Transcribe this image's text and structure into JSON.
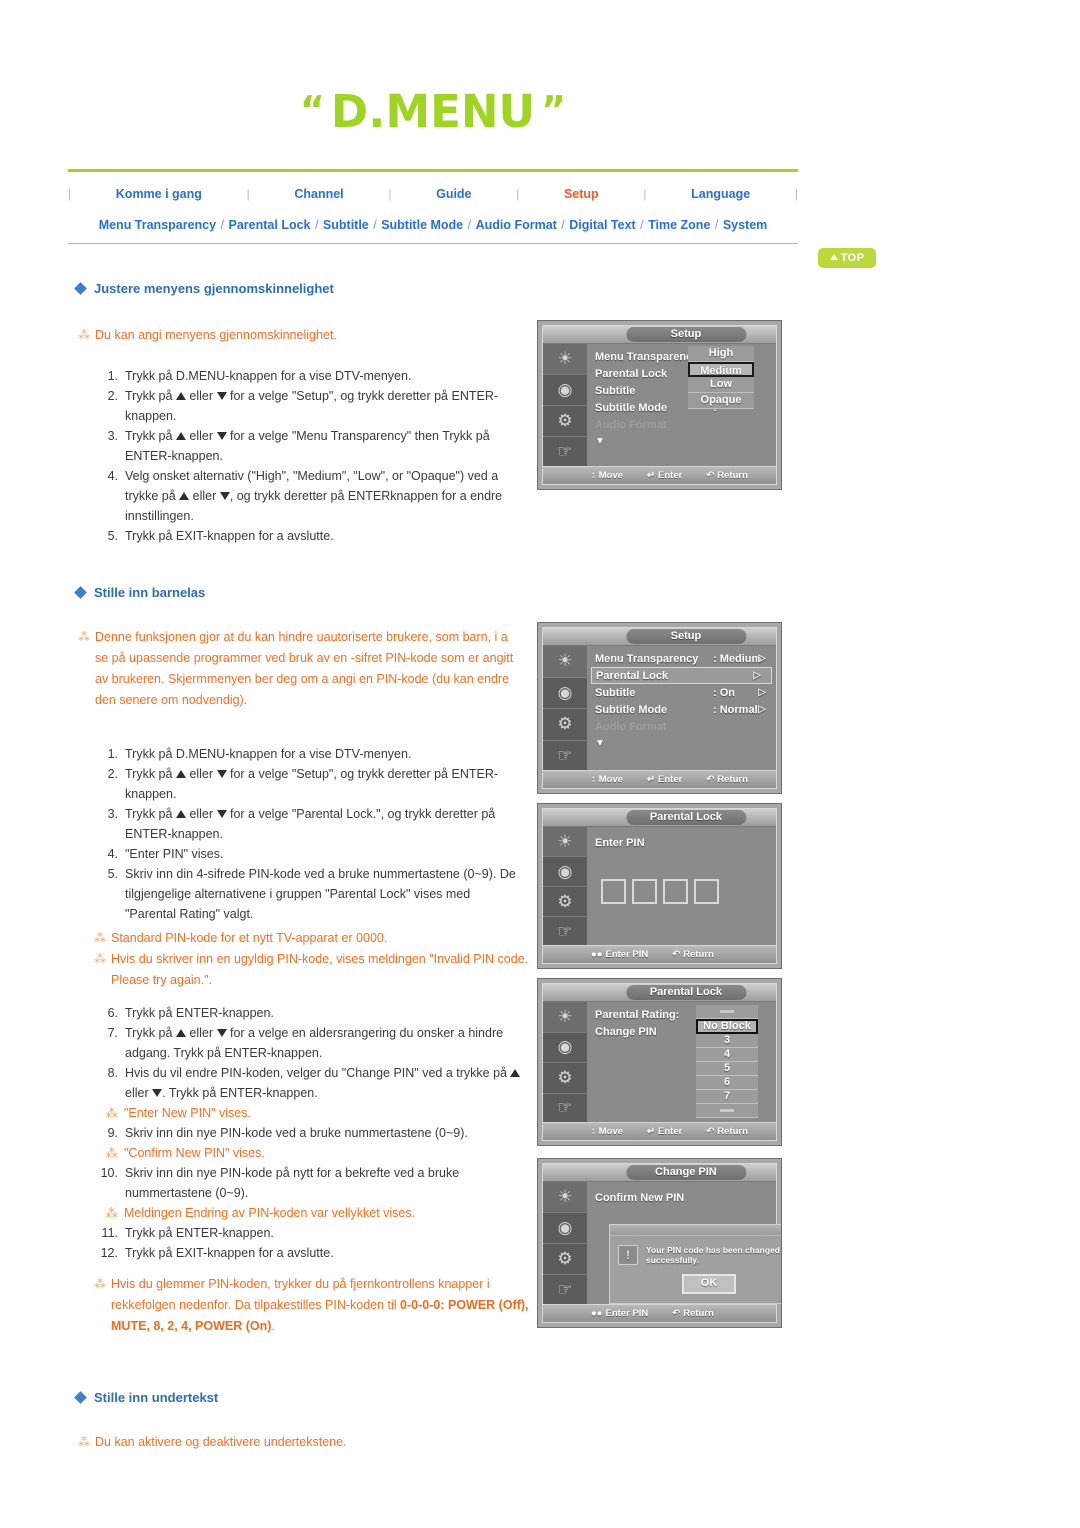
{
  "header": {
    "title": "D.MENU",
    "quote_open": "“",
    "quote_close": "”",
    "nav_items": [
      {
        "label": "Komme i gang",
        "active": false
      },
      {
        "label": "Channel",
        "active": false
      },
      {
        "label": "Guide",
        "active": false
      },
      {
        "label": "Setup",
        "active": true
      },
      {
        "label": "Language",
        "active": false
      }
    ],
    "subnav_items": [
      "Menu Transparency",
      "Parental Lock",
      "Subtitle",
      "Subtitle Mode",
      "Audio Format",
      "Digital Text",
      "Time Zone",
      "System"
    ],
    "top_button": "TOP"
  },
  "section1": {
    "heading": "Justere menyens gjennomskinnelighet",
    "note": "Du kan angi menyens gjennomskinnelighet.",
    "steps": [
      {
        "num": "1.",
        "text": "Trykk på D.MENU-knappen for a vise DTV-menyen."
      },
      {
        "num": "2.",
        "text_a": "Trykk på ",
        "text_b": " eller ",
        "text_c": " for a velge \"Setup\", og trykk deretter på ENTER-knappen."
      },
      {
        "num": "3.",
        "text_a": "Trykk på ",
        "text_b": " eller ",
        "text_c": " for a velge \"Menu Transparency\" then Trykk på ENTER-knappen."
      },
      {
        "num": "4.",
        "text_a": "Velg onsket alternativ (\"High\", \"Medium\", \"Low\", or \"Opaque\") ved a trykke på ",
        "text_b": " eller ",
        "text_c": ", og trykk deretter på ENTERknappen for a endre innstillingen."
      },
      {
        "num": "5.",
        "text": "Trykk på EXIT-knappen for a avslutte."
      }
    ]
  },
  "section2": {
    "heading": "Stille inn barnelas",
    "note": "Denne funksjonen gjor at du kan hindre uautoriserte brukere, som barn, i a se på upassende programmer ved bruk av en -sifret PIN-kode som er angitt av brukeren. Skjermmenyen ber deg om a angi en PIN-kode (du kan endre den senere om nodvendig).",
    "steps": [
      {
        "num": "1.",
        "text": "Trykk på D.MENU-knappen for a vise DTV-menyen."
      },
      {
        "num": "2.",
        "text_a": "Trykk på ",
        "text_b": " eller ",
        "text_c": " for a velge \"Setup\", og trykk deretter på ENTER-knappen."
      },
      {
        "num": "3.",
        "text_a": "Trykk på ",
        "text_b": " eller ",
        "text_c": " for a velge \"Parental Lock.\", og trykk deretter på ENTER-knappen."
      },
      {
        "num": "4.",
        "text": "\"Enter PIN\" vises."
      },
      {
        "num": "5.",
        "text": "Skriv inn din 4-sifrede PIN-kode ved a bruke nummertastene (0~9). De tilgjengelige alternativene i gruppen \"Parental Lock\" vises med \"Parental Rating\" valgt."
      }
    ],
    "notes_mid": [
      "Standard PIN-kode for et nytt TV-apparat er 0000.",
      "Hvis du skriver inn en ugyldig PIN-kode, vises meldingen \"Invalid PIN code. Please try again.\"."
    ],
    "steps2": [
      {
        "num": "6.",
        "text": "Trykk på ENTER-knappen."
      },
      {
        "num": "7.",
        "text_a": "Trykk på ",
        "text_b": " eller ",
        "text_c": " for a velge en aldersrangering du onsker a hindre adgang. Trykk på ENTER-knappen."
      },
      {
        "num": "8.",
        "text_a": "Hvis du vil endre PIN-koden, velger du \"Change PIN\" ved a trykke på ",
        "text_b": " eller ",
        "text_c": ". Trykk på ENTER-knappen."
      },
      {
        "note": "\"Enter New PIN\" vises."
      },
      {
        "num": "9.",
        "text": "Skriv inn din nye PIN-kode ved a bruke nummertastene (0~9)."
      },
      {
        "note": "\"Confirm New PIN\" vises."
      },
      {
        "num": "10.",
        "text": "Skriv inn din nye PIN-kode på nytt for a bekrefte ved a bruke nummertastene (0~9)."
      },
      {
        "note": "Meldingen Endring av PIN-koden var vellykket vises."
      },
      {
        "num": "11.",
        "text": "Trykk på ENTER-knappen."
      },
      {
        "num": "12.",
        "text": "Trykk på EXIT-knappen for a avslutte."
      }
    ],
    "note_bottom_a": "Hvis du glemmer PIN-koden, trykker du på fjernkontrollens knapper i rekkefolgen nedenfor. Da tilpakestilles PIN-koden til ",
    "note_bottom_b": "0-0-0-0: POWER (Off), MUTE, 8, 2, 4, POWER (On)",
    "note_bottom_c": "."
  },
  "section3": {
    "heading": "Stille inn undertekst",
    "note": "Du kan aktivere og deaktivere undertekstene."
  },
  "tv_screens": [
    {
      "title": "Setup",
      "rows": [
        {
          "label": "Menu Transparency",
          "sep": ":",
          "value": ""
        },
        {
          "label": "Parental Lock",
          "sep": "",
          "value": ""
        },
        {
          "label": "Subtitle",
          "sep": ":",
          "value": ""
        },
        {
          "label": "Subtitle  Mode",
          "sep": ":",
          "value": ""
        },
        {
          "label": "Audio Format",
          "sep": "",
          "value": "",
          "dim": true
        }
      ],
      "options": [
        {
          "label": "High",
          "selected": false
        },
        {
          "label": "Medium",
          "selected": true
        },
        {
          "label": "Low",
          "selected": false
        },
        {
          "label": "Opaque",
          "selected": false
        }
      ],
      "footer": [
        {
          "icon": "↕",
          "label": "Move"
        },
        {
          "icon": "↵",
          "label": "Enter"
        },
        {
          "icon": "↶",
          "label": "Return"
        }
      ]
    },
    {
      "title": "Setup",
      "rows": [
        {
          "label": "Menu Transparency",
          "sep": ":",
          "value": "Medium",
          "chev": "▷"
        },
        {
          "label": "Parental Lock",
          "sep": "",
          "value": "",
          "chev": "▷",
          "highlight": true
        },
        {
          "label": "Subtitle",
          "sep": ":",
          "value": "On",
          "chev": "▷"
        },
        {
          "label": "Subtitle  Mode",
          "sep": ":",
          "value": "Normal",
          "chev": "▷"
        },
        {
          "label": "Audio Format",
          "sep": "",
          "value": "",
          "dim": true
        }
      ],
      "footer": [
        {
          "icon": "↕",
          "label": "Move"
        },
        {
          "icon": "↵",
          "label": "Enter"
        },
        {
          "icon": "↶",
          "label": "Return"
        }
      ]
    },
    {
      "title": "Parental Lock",
      "prompt": "Enter PIN",
      "pin_digits": 4,
      "footer": [
        {
          "icon": "●●",
          "label": "Enter PIN"
        },
        {
          "icon": "↶",
          "label": "Return"
        }
      ]
    },
    {
      "title": "Parental Lock",
      "rows": [
        {
          "label": "Parental Rating:",
          "sep": "",
          "value": ""
        },
        {
          "label": "Change PIN",
          "sep": "",
          "value": ""
        }
      ],
      "ratings": [
        {
          "label": "",
          "blank": true
        },
        {
          "label": "No Block",
          "selected": true
        },
        {
          "label": "3"
        },
        {
          "label": "4"
        },
        {
          "label": "5"
        },
        {
          "label": "6"
        },
        {
          "label": "7"
        },
        {
          "label": "",
          "blank": true
        }
      ],
      "footer": [
        {
          "icon": "↕",
          "label": "Move"
        },
        {
          "icon": "↵",
          "label": "Enter"
        },
        {
          "icon": "↶",
          "label": "Return"
        }
      ]
    },
    {
      "title": "Change PIN",
      "prompt": "Confirm New PIN",
      "dialog": {
        "message": "Your PIN code has been changed successfully.",
        "ok": "OK",
        "icon": "!"
      },
      "footer": [
        {
          "icon": "●●",
          "label": "Enter PIN"
        },
        {
          "icon": "↶",
          "label": "Return"
        }
      ]
    }
  ],
  "colors": {
    "brand_green": "#9fd425",
    "nav_blue": "#2a6fd4",
    "active_orange": "#f15a22",
    "note_orange": "#f07024",
    "heading_blue": "#2e6db4"
  }
}
